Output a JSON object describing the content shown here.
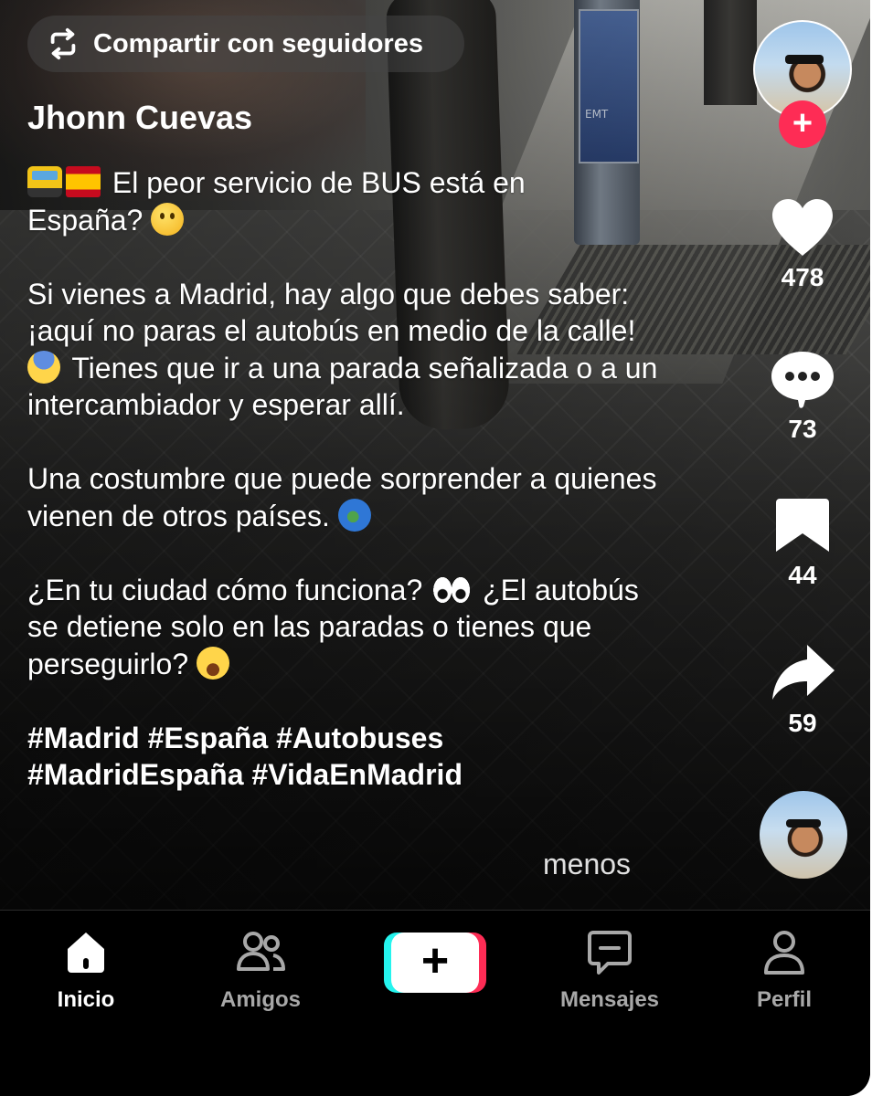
{
  "share": {
    "label": "Compartir con seguidores",
    "icon": "repost-icon"
  },
  "author": {
    "name": "Jhonn Cuevas"
  },
  "caption": {
    "line1": "El peor servicio de BUS está en",
    "line2": "España?",
    "para2": "Si vienes a Madrid, hay algo que debes saber: ¡aquí no paras el autobús en medio de la calle!",
    "para2b": "Tienes que ir a una parada señalizada o a un intercambiador y esperar allí.",
    "para3": "Una costumbre que puede sorprender a quienes vienen de otros países.",
    "para4a": "¿En tu ciudad cómo funciona?",
    "para4b": "¿El autobús se detiene solo en las paradas o tienes que perseguirlo?",
    "tags": "#Madrid #España #Autobuses #MadridEspaña #VidaEnMadrid",
    "less": "menos"
  },
  "actions": {
    "likes": "478",
    "comments": "73",
    "saves": "44",
    "shares": "59"
  },
  "nav": {
    "home": "Inicio",
    "friends": "Amigos",
    "create": "+",
    "messages": "Mensajes",
    "profile": "Perfil"
  },
  "colors": {
    "accent": "#fe2c55",
    "accent2": "#25f4ee",
    "background": "#000000"
  }
}
